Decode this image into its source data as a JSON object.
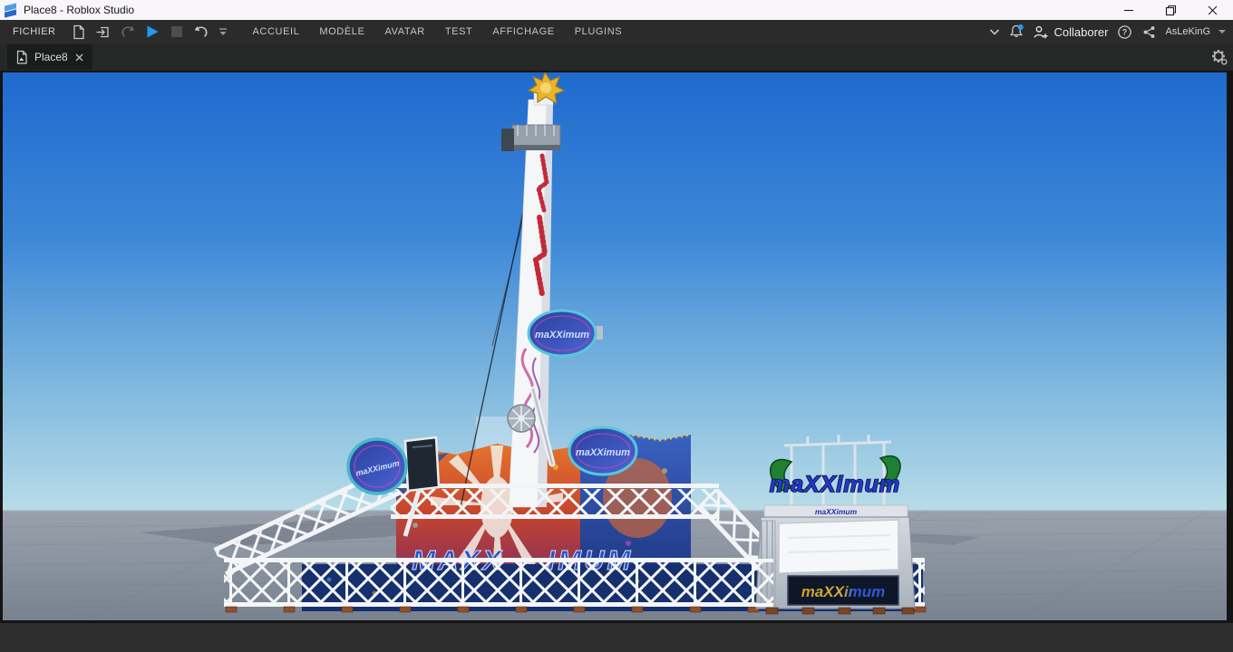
{
  "window": {
    "title": "Place8 - Roblox Studio",
    "control_icons": [
      "minimize-icon",
      "restore-icon",
      "close-icon"
    ]
  },
  "ribbon": {
    "file_menu": "FICHIER",
    "toolbar_icons": [
      "new-file-icon",
      "open-file-icon",
      "redo-icon",
      "play-icon",
      "stop-icon",
      "undo-icon",
      "toolbar-options-icon"
    ],
    "menu_tabs": [
      "ACCUEIL",
      "MODÈLE",
      "AVATAR",
      "TEST",
      "AFFICHAGE",
      "PLUGINS"
    ],
    "right": {
      "collaborate_label": "Collaborer",
      "username": "AsLeKinG",
      "icons": [
        "ribbon-collapse-icon",
        "notifications-bell-icon",
        "add-collaborator-icon",
        "help-icon",
        "share-icon",
        "user-menu-caret"
      ]
    }
  },
  "document_tab": {
    "label": "Place8"
  },
  "viewport": {
    "scene": {
      "tower_sign": "maXXimum",
      "lower_oval_sign": "maXXimum",
      "left_panel_sign": "maXXimum",
      "base_sign_left_text": "MAXX",
      "base_sign_right_text": "IMUM",
      "booth_top_sign": "maXXimum",
      "booth_roof_text": "maXXimum",
      "booth_front_sign": "maXXimum"
    }
  },
  "colors": {
    "accent_play": "#1e9bf0",
    "notification_dot": "#1e9cf0",
    "sky_top": "#1e6ace",
    "sky_horizon": "#b8dce8",
    "ground": "#8a93a0"
  }
}
